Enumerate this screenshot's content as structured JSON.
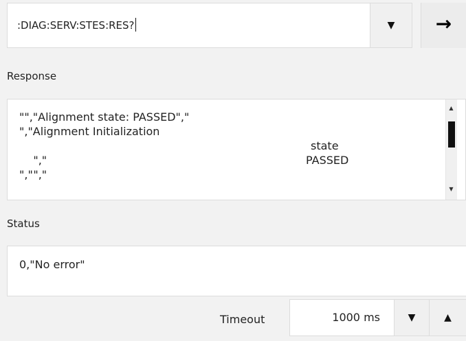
{
  "command": {
    "value": ":DIAG:SERV:STES:RES?",
    "dropdown_icon": "▼",
    "send_icon": "→"
  },
  "response": {
    "label": "Response",
    "lines": [
      "\"\",\"Alignment state: PASSED\",\"",
      "\",\"Alignment Initialization",
      "\",\"",
      "\",\"",
      "\",\""
    ],
    "right_values": [
      "state",
      "PASSED"
    ],
    "scroll_up_icon": "▲",
    "scroll_down_icon": "▼"
  },
  "status": {
    "label": "Status",
    "value": "0,\"No error\""
  },
  "timeout": {
    "label": "Timeout",
    "value": "1000 ms",
    "decrement_icon": "▼",
    "increment_icon": "▲"
  }
}
